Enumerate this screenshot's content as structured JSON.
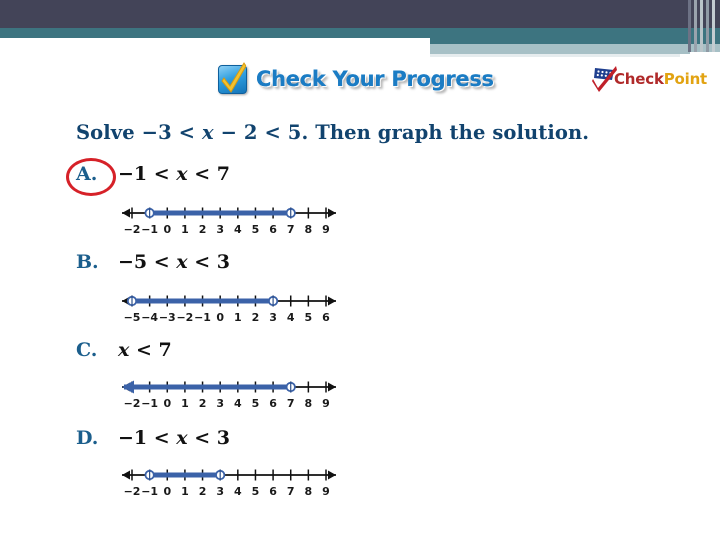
{
  "header": {
    "brand_left": {
      "icon": "checkbox-check-icon",
      "label": "Check Your Progress"
    },
    "brand_right": {
      "icon": "checkpoint-flag-icon",
      "label_part1": "Check",
      "label_part2": "Point"
    },
    "colors": {
      "band_dark": "#434458",
      "band_teal": "#3d7480",
      "band_light": "#a7c0c6"
    }
  },
  "question": {
    "prefix": "Solve ",
    "inequality_left": "−3 < ",
    "variable": "x",
    "inequality_right": " − 2 < 5.",
    "suffix": " Then graph the solution."
  },
  "selection": {
    "marked_choice": "A",
    "marker_color": "#d62128"
  },
  "choices": [
    {
      "letter": "A.",
      "expr_before": "−1 < ",
      "variable": "x",
      "expr_after": " < 7",
      "selected": true,
      "numberline": {
        "labels": [
          "−2",
          "−1",
          "0",
          "1",
          "2",
          "3",
          "4",
          "5",
          "6",
          "7",
          "8",
          "9"
        ],
        "tick_values": [
          -2,
          -1,
          0,
          1,
          2,
          3,
          4,
          5,
          6,
          7,
          8,
          9
        ],
        "segment_start": -1,
        "segment_end": 7,
        "endpoint_left": "open",
        "endpoint_right": "open",
        "arrow_left": true,
        "arrow_right": true,
        "ray_left": false,
        "ray_right": false,
        "bar_color": "#3b62a8"
      }
    },
    {
      "letter": "B.",
      "expr_before": "−5 < ",
      "variable": "x",
      "expr_after": " < 3",
      "selected": false,
      "numberline": {
        "labels": [
          "−5",
          "−4",
          "−3",
          "−2",
          "−1",
          "0",
          "1",
          "2",
          "3",
          "4",
          "5",
          "6"
        ],
        "tick_values": [
          -5,
          -4,
          -3,
          -2,
          -1,
          0,
          1,
          2,
          3,
          4,
          5,
          6
        ],
        "segment_start": -5,
        "segment_end": 3,
        "endpoint_left": "open",
        "endpoint_right": "open",
        "arrow_left": true,
        "arrow_right": true,
        "ray_left": false,
        "ray_right": false,
        "bar_color": "#3b62a8"
      }
    },
    {
      "letter": "C.",
      "expr_before": "",
      "variable": "x",
      "expr_after": " < 7",
      "selected": false,
      "numberline": {
        "labels": [
          "−2",
          "−1",
          "0",
          "1",
          "2",
          "3",
          "4",
          "5",
          "6",
          "7",
          "8",
          "9"
        ],
        "tick_values": [
          -2,
          -1,
          0,
          1,
          2,
          3,
          4,
          5,
          6,
          7,
          8,
          9
        ],
        "segment_start": -2,
        "segment_end": 7,
        "endpoint_left": "arrow",
        "endpoint_right": "open",
        "arrow_left": true,
        "arrow_right": true,
        "ray_left": true,
        "ray_right": false,
        "bar_color": "#3b62a8"
      }
    },
    {
      "letter": "D.",
      "expr_before": "−1 < ",
      "variable": "x",
      "expr_after": " < 3",
      "selected": false,
      "numberline": {
        "labels": [
          "−2",
          "−1",
          "0",
          "1",
          "2",
          "3",
          "4",
          "5",
          "6",
          "7",
          "8",
          "9"
        ],
        "tick_values": [
          -2,
          -1,
          0,
          1,
          2,
          3,
          4,
          5,
          6,
          7,
          8,
          9
        ],
        "segment_start": -1,
        "segment_end": 3,
        "endpoint_left": "open",
        "endpoint_right": "open",
        "arrow_left": true,
        "arrow_right": true,
        "ray_left": false,
        "ray_right": false,
        "bar_color": "#3b62a8"
      }
    }
  ]
}
